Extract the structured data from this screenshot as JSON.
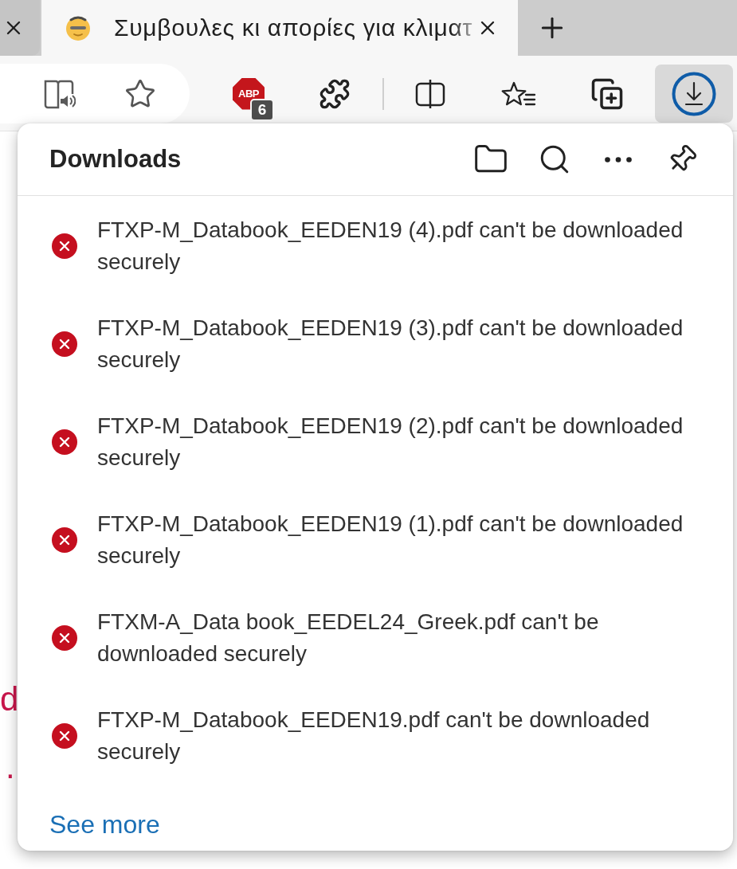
{
  "tabs": [
    {
      "selected": false
    },
    {
      "title": "Συμβουλες κι απορίες για κλιματ",
      "selected": true
    }
  ],
  "toolbar": {
    "extension": {
      "logo_text": "ABP",
      "badge": "6"
    },
    "downloads_button": {
      "selected": true
    }
  },
  "page_fragments": [
    {
      "text": "d",
      "color": "#c8164b"
    },
    {
      "text": ".",
      "color": "#c8164b"
    }
  ],
  "downloads_panel": {
    "title": "Downloads",
    "items": [
      {
        "text": "FTXP-M_Databook_EEDEN19 (4).pdf can't be downloaded securely",
        "kind": "error"
      },
      {
        "text": "FTXP-M_Databook_EEDEN19 (3).pdf can't be downloaded securely",
        "kind": "error"
      },
      {
        "text": "FTXP-M_Databook_EEDEN19 (2).pdf can't be downloaded securely",
        "kind": "error"
      },
      {
        "text": "FTXP-M_Databook_EEDEN19 (1).pdf can't be downloaded securely",
        "kind": "error"
      },
      {
        "text": "FTXM-A_Data book_EEDEL24_Greek.pdf can't be downloaded securely",
        "kind": "error"
      },
      {
        "text": "FTXP-M_Databook_EEDEN19.pdf can't be downloaded securely",
        "kind": "error"
      }
    ],
    "see_more": "See more"
  }
}
